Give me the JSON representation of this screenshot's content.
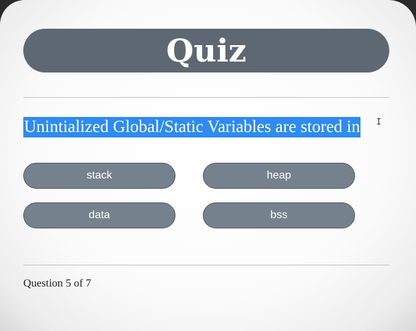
{
  "quiz": {
    "title": "Quiz",
    "question": "Unintialized Global/Static Variables are stored in",
    "options": [
      "stack",
      "heap",
      "data",
      "bss"
    ],
    "progress": "Question 5 of 7",
    "cursor_glyph": "I"
  },
  "colors": {
    "title_bar": "#5d6872",
    "option_bg": "#75818d",
    "selection_highlight": "#2e8bf0"
  }
}
